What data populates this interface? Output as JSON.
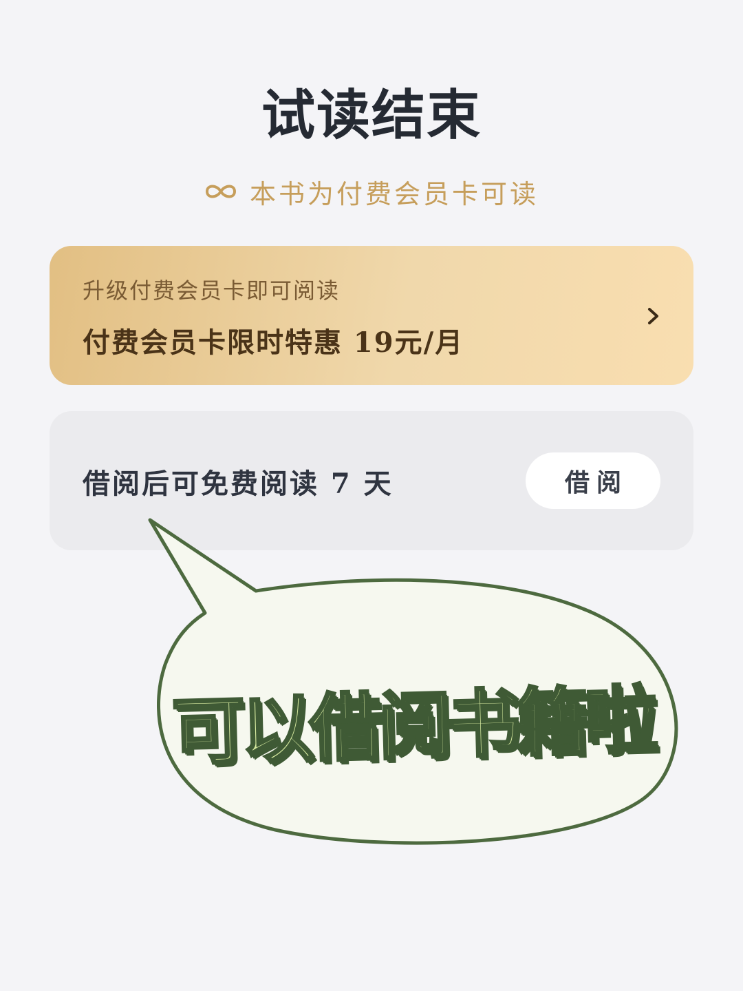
{
  "header": {
    "title": "试读结束",
    "subtitle": "本书为付费会员卡可读",
    "subtitle_icon": "infinity-icon"
  },
  "vip_card": {
    "upgrade_text": "升级付费会员卡即可阅读",
    "offer_text": "付费会员卡限时特惠 19元/月",
    "chevron_icon": "chevron-right-icon"
  },
  "borrow_card": {
    "description": "借阅后可免费阅读 7 天",
    "button_label": "借阅"
  },
  "annotation": {
    "callout_text": "可以借阅书籍啦"
  },
  "colors": {
    "background": "#f4f4f7",
    "title": "#252a33",
    "gold_accent": "#c69e5b",
    "vip_gradient_start": "#e2bf83",
    "vip_gradient_end": "#f9deb0",
    "borrow_card_bg": "#ebebee",
    "bubble_fill": "#f6f8ef",
    "bubble_stroke": "#4d6a3f",
    "callout_fill": "#d7eaa0"
  }
}
